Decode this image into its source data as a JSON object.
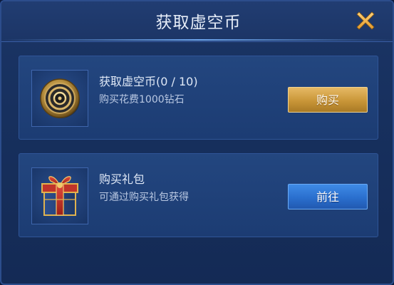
{
  "dialog": {
    "title": "获取虚空币"
  },
  "buy_coin": {
    "title": "获取虚空币(0 / 10)",
    "description": "购买花费1000钻石",
    "button_label": "购买",
    "icon": "void-coin-icon"
  },
  "buy_pack": {
    "title": "购买礼包",
    "description": "可通过购买礼包获得",
    "button_label": "前往",
    "icon": "gift-box-icon"
  },
  "colors": {
    "background": "#17305e",
    "gold_button": "#c99638",
    "blue_button": "#2a6fce",
    "close_icon": "#f2b347"
  }
}
